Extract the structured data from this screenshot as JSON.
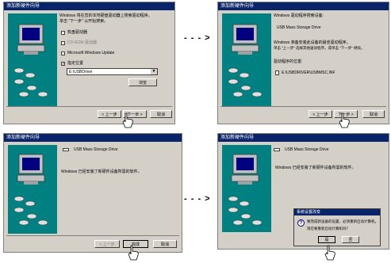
{
  "wizard_title": "添加新硬件向导",
  "msgbox_title": "系统设置改变",
  "arrow": "- - - >",
  "panel1": {
    "intro_line1": "Windows 将在您的本地硬盘驱动器上搜索驱动程序。",
    "intro_line2": "单击 “下一步” 以开始搜索。",
    "opt_floppy": "软盘驱动器",
    "opt_cdrom": "CD-ROM 驱动器",
    "opt_update": "Microsoft Windows Update",
    "opt_location": "指定位置",
    "path_value": "E:\\USBDriver",
    "browse": "浏览",
    "back": "< 上一步",
    "next": "下一步 >",
    "cancel": "取消"
  },
  "panel2": {
    "line1": "Windows 驱动程序搜索设备:",
    "device": "USB Mass Storage Drive",
    "line2": "Windows 准备安装此设备的最佳驱动程序。",
    "line3": "单击 “上一步” 选择其他驱动程序，或单击 “下一步” 继续。",
    "location_label": "驱动程序的位置:",
    "file_path": "E:\\USBDRIVER\\USBMSC.INF",
    "back": "< 上一步",
    "next": "下一步 >",
    "cancel": "取消"
  },
  "panel3": {
    "device": "USB Mass Storage Drive",
    "done": "Windows 已经安装了新硬件设备所需的软件。",
    "back": "< 上一步",
    "finish": "完成",
    "cancel": "取消"
  },
  "panel4": {
    "device": "USB Mass Storage Drive",
    "done": "Windows 已经安装了新硬件设备所需的软件。",
    "msg_line1": "要完成新设备的设置，必须重新启动计算机。",
    "msg_line2": "现在要重新启动计算机吗？",
    "yes": "是",
    "no": "否"
  }
}
